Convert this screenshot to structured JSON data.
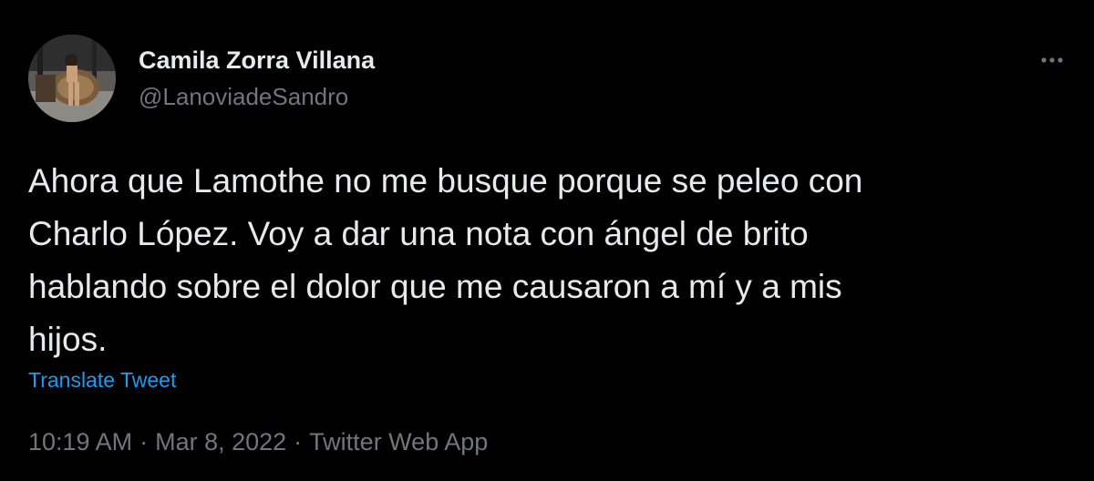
{
  "author": {
    "display_name": "Camila Zorra Villana",
    "handle": "@LanoviadeSandro"
  },
  "tweet": {
    "text": "Ahora que Lamothe no me busque porque se peleo con\nCharlo López. Voy a dar una nota con ángel de brito\nhablando sobre el dolor que me causaron a mí y a mis\nhijos.",
    "translate_label": "Translate Tweet"
  },
  "meta": {
    "time": "10:19 AM",
    "separator": "·",
    "date": "Mar 8, 2022",
    "source": "Twitter Web App"
  },
  "icons": {
    "more": "more-horizontal-icon"
  },
  "colors": {
    "background": "#000000",
    "text_primary": "#e7e9ea",
    "text_secondary": "#71767b",
    "link": "#1d9bf0"
  }
}
